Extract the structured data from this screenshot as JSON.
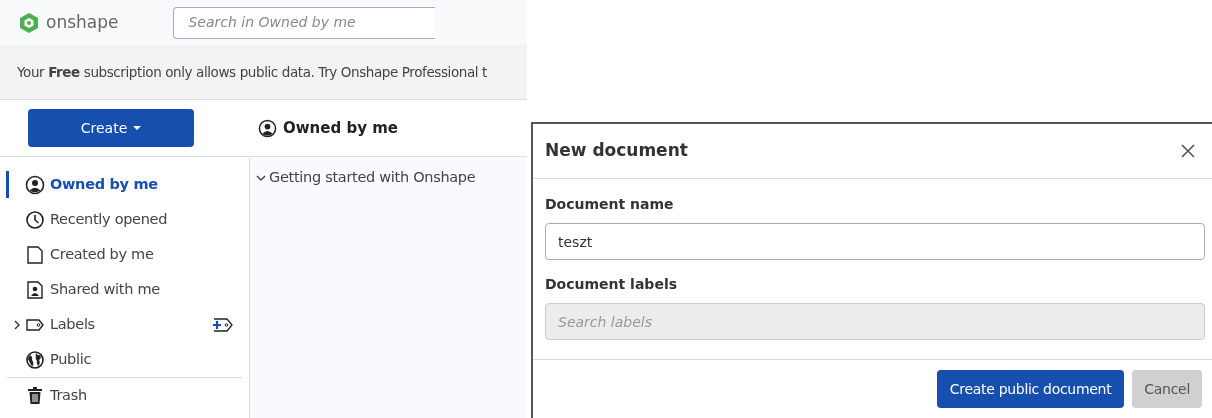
{
  "app": {
    "logo_text": "onshape",
    "search": {
      "placeholder": "Search in Owned by me"
    }
  },
  "banner": "Your **Free** subscription only allows public data. Try Onshape Professional t",
  "create_button": "Create",
  "content_title": "Owned by me",
  "sidebar": {
    "items": [
      {
        "label": "Owned by me",
        "selected": true
      },
      {
        "label": "Recently opened",
        "selected": false
      },
      {
        "label": "Created by me",
        "selected": false
      },
      {
        "label": "Shared with me",
        "selected": false
      },
      {
        "label": "Labels",
        "selected": false,
        "expanded": false
      },
      {
        "label": "Public",
        "selected": false
      }
    ],
    "footer_items": [
      {
        "label": "Trash",
        "selected": false
      }
    ]
  },
  "tree": [
    {
      "label": "Getting started with Onshape",
      "expanded": true
    }
  ],
  "dialog": {
    "title": "New document",
    "fields": [
      {
        "label": "Document name",
        "value": "teszt",
        "disabled": false
      },
      {
        "label": "Document labels",
        "placeholder": "Search labels",
        "disabled": true
      }
    ],
    "buttons": [
      {
        "label": "Create public document",
        "kind": "primary"
      },
      {
        "label": "Cancel",
        "kind": "secondary"
      }
    ]
  }
}
